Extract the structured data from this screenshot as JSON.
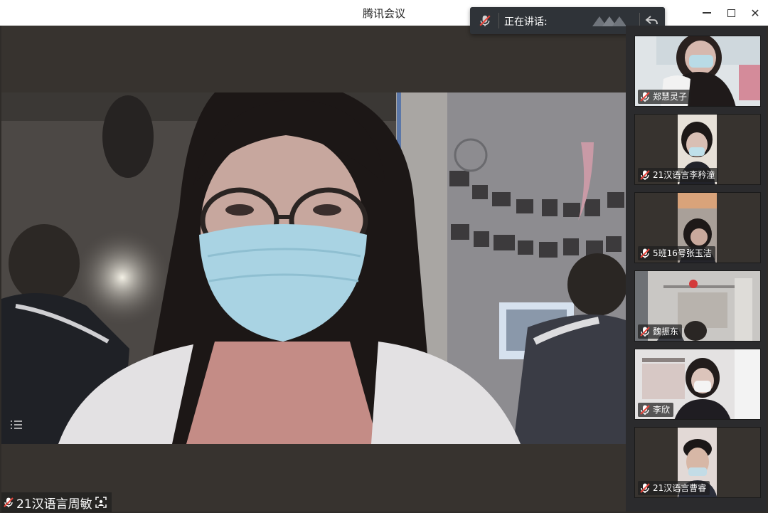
{
  "window": {
    "title": "腾讯会议"
  },
  "speaker_bar": {
    "label": "正在讲话:"
  },
  "main": {
    "participant_name": "21汉语言周敏"
  },
  "participants": [
    {
      "name": "郑慧灵子"
    },
    {
      "name": "21汉语言李矜潼"
    },
    {
      "name": "5班16号张玉洁"
    },
    {
      "name": "魏振东"
    },
    {
      "name": "李欣"
    },
    {
      "name": "21汉语言曹睿"
    }
  ],
  "colors": {
    "mic_red": "#e8453c",
    "titlebar": "#ffffff",
    "panel": "#2b2b2d"
  }
}
